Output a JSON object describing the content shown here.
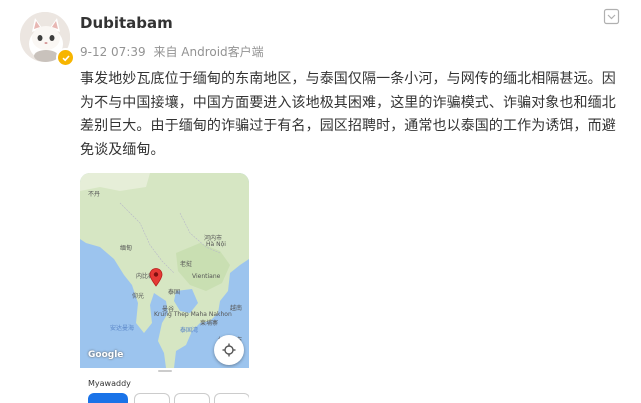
{
  "user": {
    "name": "Dubitabam",
    "verified": true
  },
  "post": {
    "date": "9-12 07:39",
    "source": "来自 Android客户端",
    "content": "事发地妙瓦底位于缅甸的东南地区，与泰国仅隔一条小河，与网传的缅北相隔甚远。因为不与中国接壤，中国方面要进入该地极其困难，这里的诈骗模式、诈骗对象也和缅北差别巨大。由于缅甸的诈骗过于有名，园区招聘时，通常也以泰国的工作为诱饵，而避免谈及缅甸。"
  },
  "map": {
    "labels": {
      "bhutan": "不丹",
      "myanmar": "缅甸",
      "laos": "老挝",
      "hanoi": "河内市",
      "hanoi_en": "Hà Nội",
      "thailand": "泰国",
      "vientiane_en": "Vientiane",
      "bangkok": "曼谷",
      "bangkok_en": "Krung Thep\nMaha Nakhon",
      "vietnam": "越南",
      "cambodia": "柬埔寨",
      "ho_chi_minh": "胡志明市",
      "nay_pyi_taw": "内比都",
      "yangon": "仰光",
      "andaman_sea": "安达曼海",
      "gulf_thailand": "泰国湾"
    },
    "logo": "Google",
    "place_name": "Myawaddy"
  },
  "colors": {
    "accent": "#1a73e8",
    "badge": "#f7b500",
    "meta": "#939393",
    "water": "#9cc4ee",
    "land": "#d8e8c8"
  }
}
